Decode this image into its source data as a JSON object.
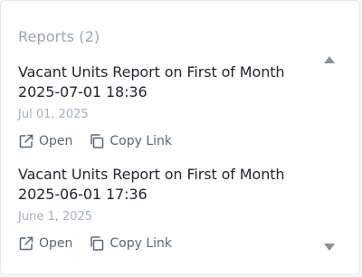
{
  "panel": {
    "title": "Reports (2)"
  },
  "reports": [
    {
      "title_line1": "Vacant Units Report on First of Month",
      "title_line2": "2025-07-01 18:36",
      "date": "Jul 01, 2025",
      "open_label": "Open",
      "copy_label": "Copy Link"
    },
    {
      "title_line1": "Vacant Units Report on First of Month",
      "title_line2": "2025-06-01 17:36",
      "date": "June 1, 2025",
      "open_label": "Open",
      "copy_label": "Copy Link"
    }
  ],
  "icons": {
    "open": "external-link-icon",
    "copy": "copy-icon",
    "scroll_up": "triangle-up-icon",
    "scroll_down": "triangle-down-icon"
  },
  "colors": {
    "title": "#9aa5b4",
    "text": "#22262c",
    "date": "#a6b0bd",
    "action": "#5b6673",
    "scroll_arrow": "#8a9098"
  }
}
